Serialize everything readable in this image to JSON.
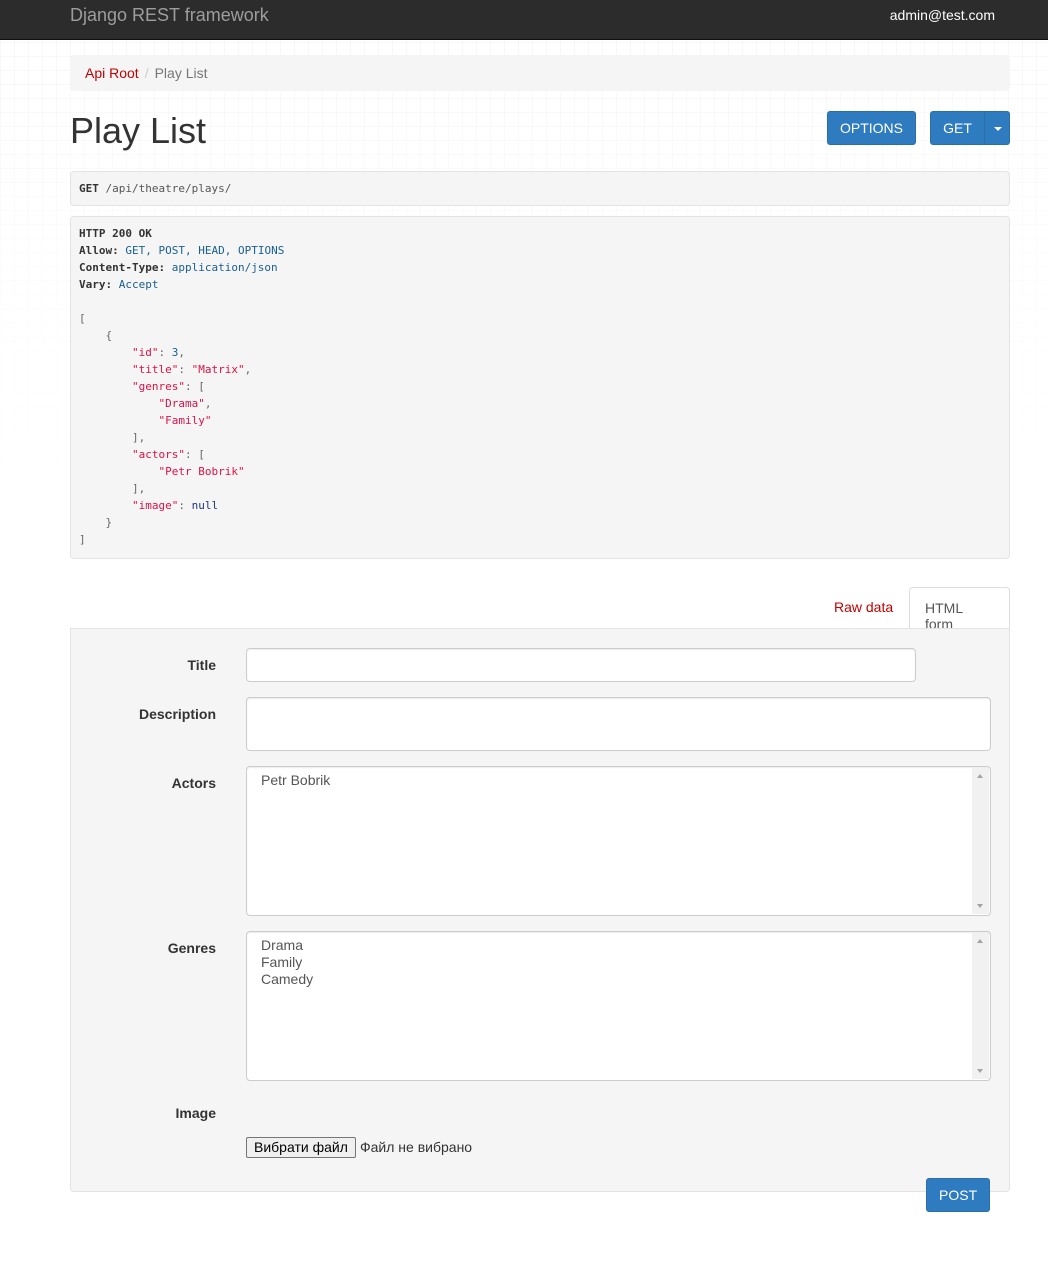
{
  "navbar": {
    "brand": "Django REST framework",
    "user": "admin@test.com"
  },
  "breadcrumb": {
    "root": "Api Root",
    "separator": "/",
    "current": "Play List"
  },
  "page": {
    "title": "Play List",
    "options_label": "OPTIONS",
    "get_label": "GET"
  },
  "request": {
    "method": "GET",
    "url": "/api/theatre/plays/"
  },
  "response": {
    "status": "HTTP 200 OK",
    "headers": [
      {
        "name": "Allow:",
        "value": "GET, POST, HEAD, OPTIONS"
      },
      {
        "name": "Content-Type:",
        "value": "application/json"
      },
      {
        "name": "Vary:",
        "value": "Accept"
      }
    ],
    "body": {
      "id": 3,
      "title": "Matrix",
      "genres": [
        "Drama",
        "Family"
      ],
      "actors": [
        "Petr Bobrik"
      ],
      "image": "null"
    }
  },
  "tabs": {
    "raw": "Raw data",
    "html": "HTML form"
  },
  "form": {
    "title_label": "Title",
    "title_value": "",
    "description_label": "Description",
    "description_value": "",
    "actors_label": "Actors",
    "actors_options": [
      "Petr Bobrik"
    ],
    "genres_label": "Genres",
    "genres_options": [
      "Drama",
      "Family",
      "Camedy"
    ],
    "image_label": "Image",
    "file_button": "Вибрати файл",
    "file_status": "Файл не вибрано",
    "submit_label": "POST"
  },
  "colors": {
    "navbar_bg": "#2c2c2c",
    "link": "#c20000",
    "button": "#2f7bbf"
  }
}
